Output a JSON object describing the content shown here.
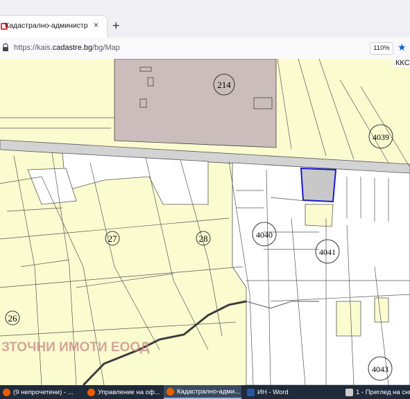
{
  "browser": {
    "tab_title": "Кадастрално-административн",
    "tab_close": "×",
    "new_tab": "+",
    "url_prefix": "https://kais.",
    "url_domain": "cadastre.bg",
    "url_path": "/bg/Map",
    "zoom": "110%",
    "accent_color": "#0061e0"
  },
  "map": {
    "corner_label": "ККС",
    "parcel_labels": [
      "214",
      "4039",
      "27",
      "28",
      "4040",
      "4041",
      "26",
      "4043"
    ],
    "watermark": "ЗТОЧНИ ИМОТИ ЕООД",
    "colors": {
      "land": "#fbfbd0",
      "industrial": "#cbbdbb",
      "white_plot": "#ffffff",
      "selected": "#c8c8c8",
      "selection_border": "#1a1acc",
      "river": "#3c3c3c"
    }
  },
  "taskbar": {
    "items": [
      {
        "label": "(9 непрочетени) - ...",
        "icon": "firefox-icon"
      },
      {
        "label": "Управление на оф...",
        "icon": "firefox-icon"
      },
      {
        "label": "Кадастрално-адми...",
        "icon": "firefox-icon"
      },
      {
        "label": "ИН - Word",
        "icon": "word-icon"
      },
      {
        "label": "1 - Преглед на сни...",
        "icon": "app-icon"
      }
    ]
  }
}
